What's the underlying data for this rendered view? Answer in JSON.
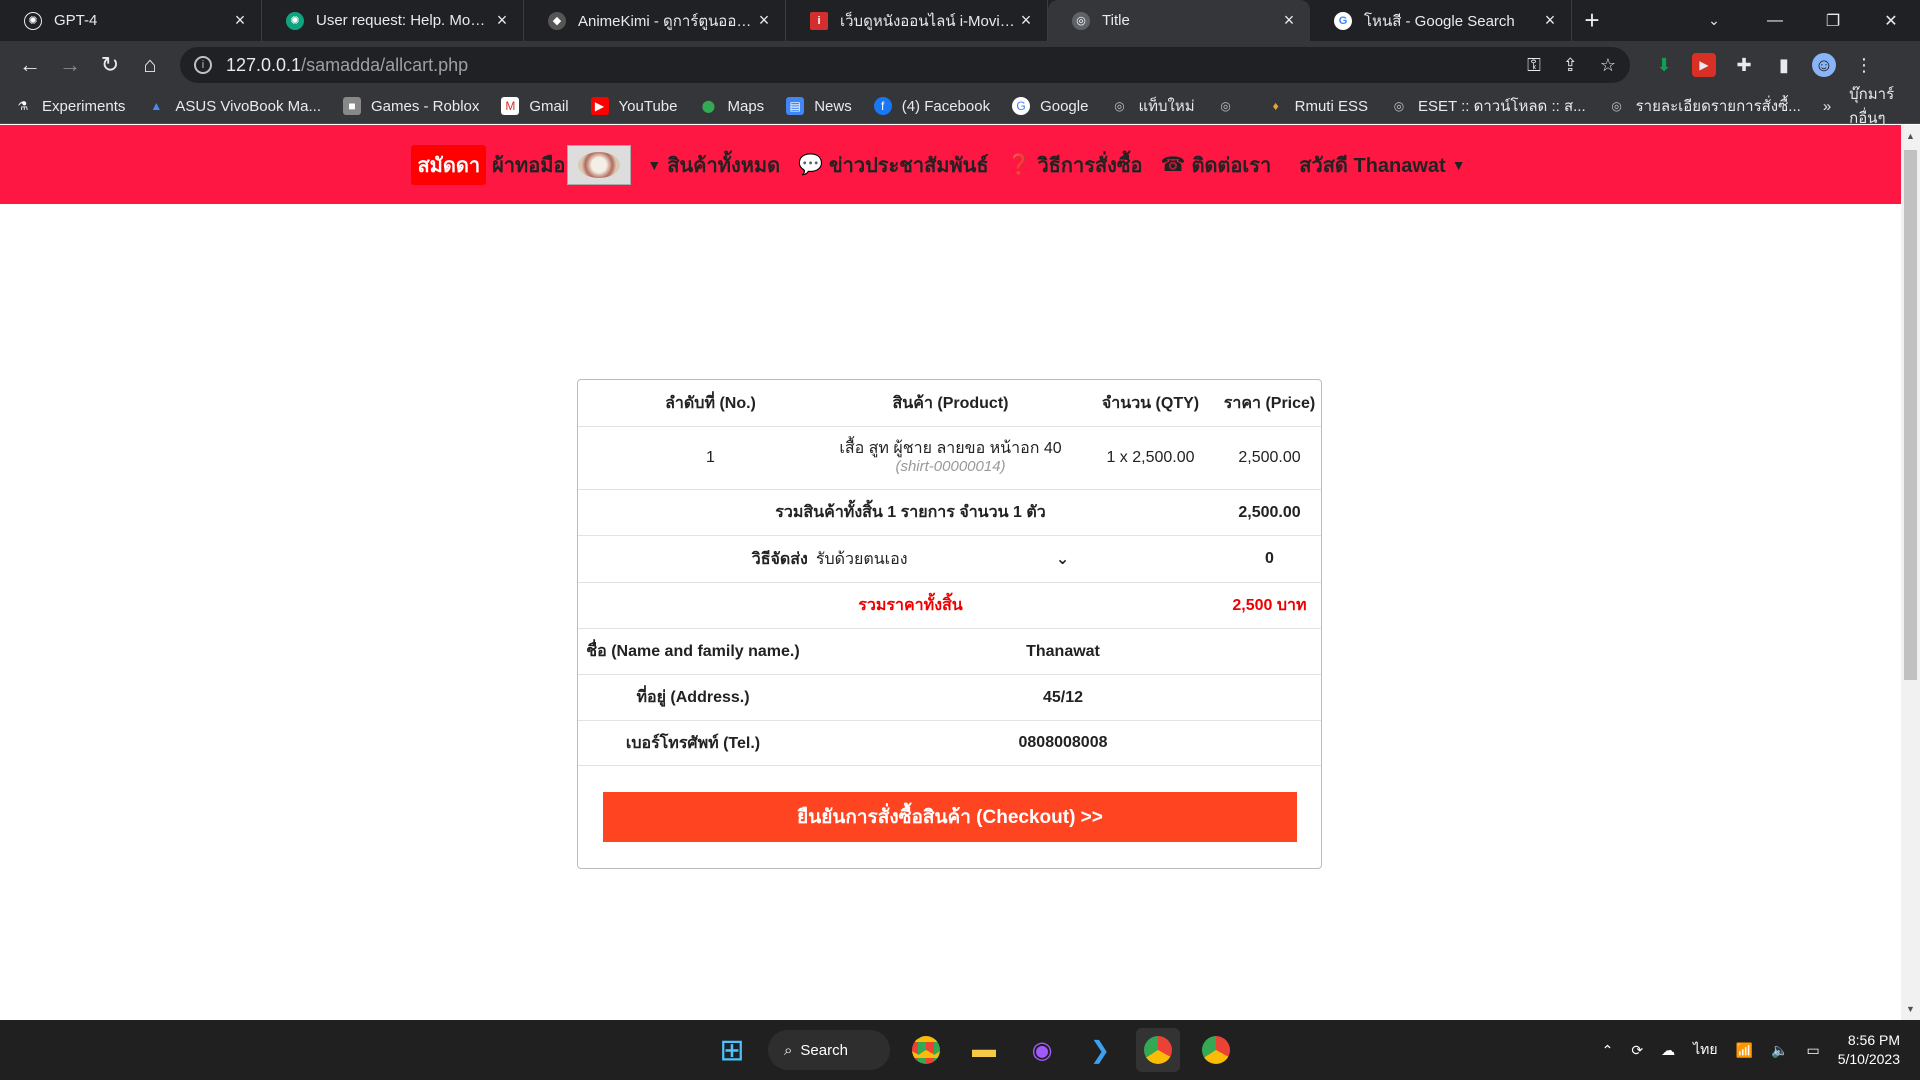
{
  "tabs": [
    {
      "title": "GPT-4",
      "icon": "openai-icon",
      "color": "#202124"
    },
    {
      "title": "User request: Help. Model r",
      "icon": "openai-icon",
      "color": "#10a37f"
    },
    {
      "title": "AnimeKimi - ดูการ์ตูนออนไลน์",
      "icon": "anime-icon",
      "color": "#444"
    },
    {
      "title": "เว็บดูหนังออนไลน์ i-MovieHD (",
      "icon": "imovie-icon",
      "color": "#d32f2f"
    },
    {
      "title": "Title",
      "icon": "globe-icon",
      "color": "#5f6368"
    },
    {
      "title": "โหนสี - Google Search",
      "icon": "google-icon",
      "color": "#fff"
    }
  ],
  "address": {
    "host": "127.0.0.1",
    "path": "/samadda/allcart.php"
  },
  "bookmarks": [
    {
      "label": "Experiments"
    },
    {
      "label": "ASUS VivoBook Ma..."
    },
    {
      "label": "Games - Roblox"
    },
    {
      "label": "Gmail"
    },
    {
      "label": "YouTube"
    },
    {
      "label": "Maps"
    },
    {
      "label": "News"
    },
    {
      "label": "(4) Facebook"
    },
    {
      "label": "Google"
    },
    {
      "label": "แท็บใหม่"
    },
    {
      "label": ""
    },
    {
      "label": "Rmuti ESS"
    },
    {
      "label": "ESET :: ดาวน์โหลด :: ส..."
    },
    {
      "label": "รายละเอียดรายการสั่งซื้..."
    }
  ],
  "bookmarks_more": "»",
  "bookmarks_other": "บุ๊กมาร์กอื่นๆ",
  "navbar": {
    "brand": "สมัดดา",
    "brand_sub": "ผ้าทอมือ",
    "links": [
      {
        "label": "สินค้าทั้งหมด",
        "icon": "caret-down-icon"
      },
      {
        "label": "ข่าวประชาสัมพันธ์",
        "icon": "comments-icon"
      },
      {
        "label": "วิธีการสั่งซื้อ",
        "icon": "question-circle-icon"
      },
      {
        "label": "ติดต่อเรา",
        "icon": "phone-icon"
      }
    ],
    "greeting": "สวัสดี Thanawat"
  },
  "cart": {
    "headers": {
      "no": "ลำดับที่ (No.)",
      "product": "สินค้า (Product)",
      "qty": "จำนวน (QTY)",
      "price": "ราคา (Price)"
    },
    "items": [
      {
        "no": "1",
        "name": "เสื้อ สูท ผู้ชาย ลายขอ หน้าอก 40",
        "sku": "(shirt-00000014)",
        "qty": "1 x 2,500.00",
        "price": "2,500.00"
      }
    ],
    "summary_label": "รวมสินค้าทั้งสิ้น 1 รายการ จำนวน 1 ตัว",
    "summary_value": "2,500.00",
    "shipping_label": "วิธีจัดส่ง",
    "shipping_value": "รับด้วยตนเอง",
    "shipping_cost": "0",
    "total_label": "รวมราคาทั้งสิ้น",
    "total_value": "2,500 บาท",
    "name_label": "ชื่อ (Name and family name.)",
    "name_value": "Thanawat",
    "address_label": "ที่อยู่ (Address.)",
    "address_value": "45/12",
    "tel_label": "เบอร์โทรศัพท์ (Tel.)",
    "tel_value": "0808008008",
    "checkout_label": "ยืนยันการสั่งซื้อสินค้า (Checkout) >>"
  },
  "taskbar": {
    "search_label": "Search",
    "lang": "ไทย",
    "time": "8:56 PM",
    "date": "5/10/2023"
  },
  "colors": {
    "nav_bg": "#ff1744",
    "brand_bg": "#ff0000",
    "checkout_bg": "#ff4422",
    "total_text": "#ee0000"
  }
}
